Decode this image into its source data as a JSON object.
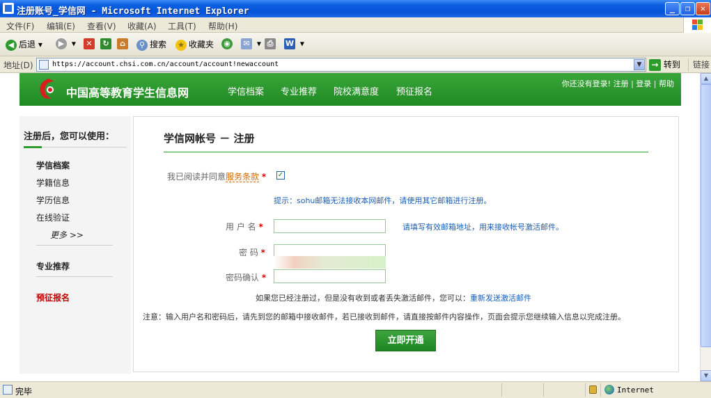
{
  "window": {
    "title": "注册账号_学信网 - Microsoft Internet Explorer",
    "controls": [
      "_",
      "❐",
      "✕"
    ]
  },
  "menu": [
    "文件(F)",
    "编辑(E)",
    "查看(V)",
    "收藏(A)",
    "工具(T)",
    "帮助(H)"
  ],
  "toolbar": {
    "back": "后退",
    "search": "搜索",
    "favorites": "收藏夹"
  },
  "address": {
    "label": "地址(D)",
    "url": "https://account.chsi.com.cn/account/account!newaccount",
    "go": "转到",
    "links": "链接"
  },
  "site": {
    "name": "中国高等教育学生信息网",
    "nav": [
      "学信档案",
      "专业推荐",
      "院校满意度",
      "预征报名"
    ],
    "userbar": "你还没有登录! 注册 | 登录 | 帮助",
    "brand_color": "#2d9a2d"
  },
  "sidebar": {
    "title": "注册后，您可以使用：",
    "items": [
      "学信档案",
      "学籍信息",
      "学历信息",
      "在线验证"
    ],
    "more": "更多 >>",
    "recommend": "专业推荐",
    "signup": "预征报名"
  },
  "form": {
    "title": "学信网帐号 － 注册",
    "agree_text": "我已阅读并同意",
    "terms_link": "服务条款",
    "agree_checked": true,
    "required_mark": "*",
    "tip_sohu": "提示：sohu邮箱无法接收本网邮件，请使用其它邮箱进行注册。",
    "username_label": "用 户 名",
    "username_hint": "请填写有效邮箱地址，用来接收帐号激活邮件。",
    "password_label": "密 码",
    "confirm_label": "密码确认",
    "resend_text": "如果您已经注册过，但是没有收到或者丢失激活邮件，您可以：",
    "resend_link": "重新发送激活邮件",
    "notice": "注意：输入用户名和密码后，请先到您的邮箱中接收邮件，若已接收到邮件，请直接按邮件内容操作，页面会提示您继续输入信息以完成注册。",
    "submit": "立即开通"
  },
  "status": {
    "text": "完毕",
    "zone": "Internet"
  }
}
